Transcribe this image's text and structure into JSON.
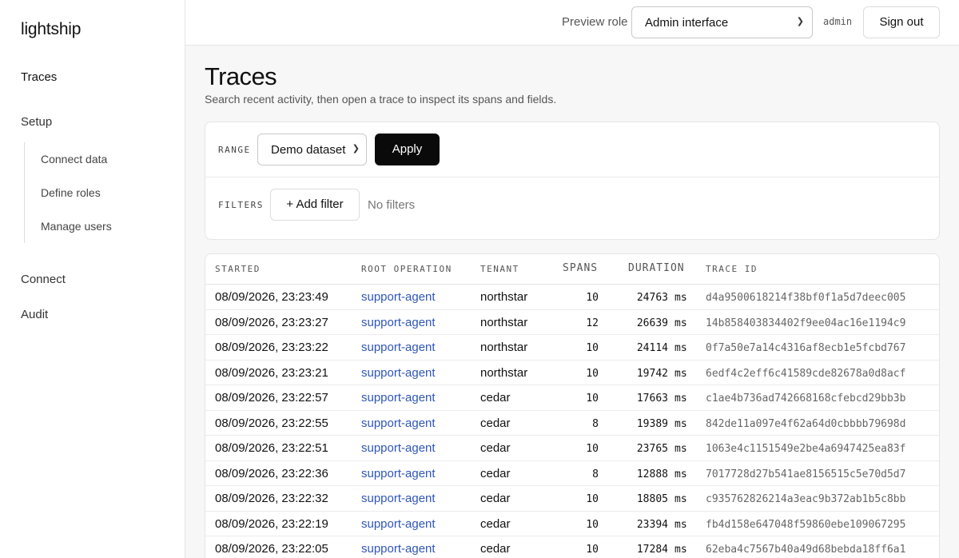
{
  "sidebar": {
    "brand": "lightship",
    "items": [
      {
        "label": "Traces"
      },
      {
        "label": "Setup"
      },
      {
        "label": "Connect"
      },
      {
        "label": "Audit"
      }
    ],
    "setup_children": [
      {
        "label": "Connect data"
      },
      {
        "label": "Define roles"
      },
      {
        "label": "Manage users"
      }
    ]
  },
  "header": {
    "preview_label": "Preview role",
    "role_value": "Admin interface",
    "username": "admin",
    "signout_label": "Sign out"
  },
  "page": {
    "title": "Traces",
    "subtitle": "Search recent activity, then open a trace to inspect its spans and fields."
  },
  "controls": {
    "range_label": "RANGE",
    "range_value": "Demo dataset",
    "apply_label": "Apply",
    "filters_label": "FILTERS",
    "add_filter_label": "+ Add filter",
    "no_filters_text": "No filters"
  },
  "table": {
    "columns": [
      "STARTED",
      "ROOT OPERATION",
      "TENANT",
      "SPANS",
      "DURATION",
      "TRACE ID"
    ],
    "duration_unit": "ms",
    "rows": [
      {
        "started": "08/09/2026, 23:23:49",
        "op": "support-agent",
        "tenant": "northstar",
        "spans": "10",
        "duration": "24763",
        "trace_id": "d4a9500618214f38bf0f1a5d7deec005"
      },
      {
        "started": "08/09/2026, 23:23:27",
        "op": "support-agent",
        "tenant": "northstar",
        "spans": "12",
        "duration": "26639",
        "trace_id": "14b858403834402f9ee04ac16e1194c9"
      },
      {
        "started": "08/09/2026, 23:23:22",
        "op": "support-agent",
        "tenant": "northstar",
        "spans": "10",
        "duration": "24114",
        "trace_id": "0f7a50e7a14c4316af8ecb1e5fcbd767"
      },
      {
        "started": "08/09/2026, 23:23:21",
        "op": "support-agent",
        "tenant": "northstar",
        "spans": "10",
        "duration": "19742",
        "trace_id": "6edf4c2eff6c41589cde82678a0d8acf"
      },
      {
        "started": "08/09/2026, 23:22:57",
        "op": "support-agent",
        "tenant": "cedar",
        "spans": "10",
        "duration": "17663",
        "trace_id": "c1ae4b736ad742668168cfebcd29bb3b"
      },
      {
        "started": "08/09/2026, 23:22:55",
        "op": "support-agent",
        "tenant": "cedar",
        "spans": "8",
        "duration": "19389",
        "trace_id": "842de11a097e4f62a64d0cbbbb79698d"
      },
      {
        "started": "08/09/2026, 23:22:51",
        "op": "support-agent",
        "tenant": "cedar",
        "spans": "10",
        "duration": "23765",
        "trace_id": "1063e4c1151549e2be4a6947425ea83f"
      },
      {
        "started": "08/09/2026, 23:22:36",
        "op": "support-agent",
        "tenant": "cedar",
        "spans": "8",
        "duration": "12888",
        "trace_id": "7017728d27b541ae8156515c5e70d5d7"
      },
      {
        "started": "08/09/2026, 23:22:32",
        "op": "support-agent",
        "tenant": "cedar",
        "spans": "10",
        "duration": "18805",
        "trace_id": "c935762826214a3eac9b372ab1b5c8bb"
      },
      {
        "started": "08/09/2026, 23:22:19",
        "op": "support-agent",
        "tenant": "cedar",
        "spans": "10",
        "duration": "23394",
        "trace_id": "fb4d158e647048f59860ebe109067295"
      },
      {
        "started": "08/09/2026, 23:22:05",
        "op": "support-agent",
        "tenant": "cedar",
        "spans": "10",
        "duration": "17284",
        "trace_id": "62eba4c7567b40a49d68bebda18ff6a1"
      }
    ]
  }
}
